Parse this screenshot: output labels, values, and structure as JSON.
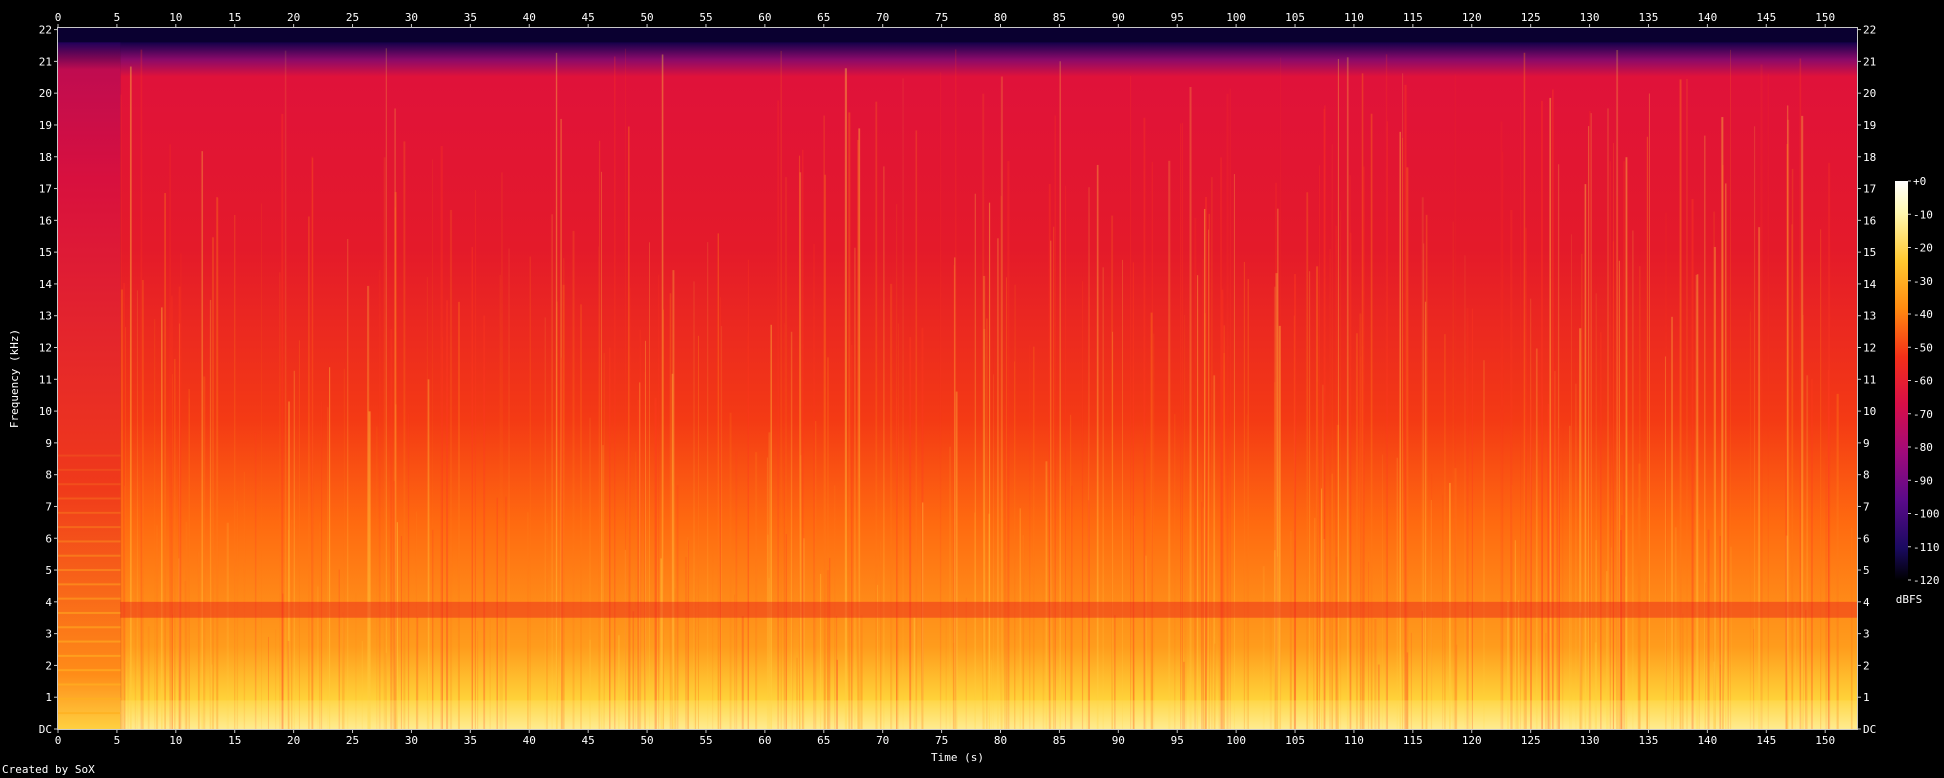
{
  "chart_data": {
    "type": "heatmap",
    "title": "",
    "xlabel": "Time (s)",
    "ylabel": "Frequency (kHz)",
    "x_range": [
      0,
      152.7
    ],
    "y_range": [
      0,
      22.05
    ],
    "x_ticks": [
      0,
      5,
      10,
      15,
      20,
      25,
      30,
      35,
      40,
      45,
      50,
      55,
      60,
      65,
      70,
      75,
      80,
      85,
      90,
      95,
      100,
      105,
      110,
      115,
      120,
      125,
      130,
      135,
      140,
      145,
      150
    ],
    "y_ticks": [
      "DC",
      "1",
      "2",
      "3",
      "4",
      "5",
      "6",
      "7",
      "8",
      "9",
      "10",
      "11",
      "12",
      "13",
      "14",
      "15",
      "16",
      "17",
      "18",
      "19",
      "20",
      "21",
      "22"
    ],
    "colorbar": {
      "label": "dBFS",
      "ticks": [
        "+0",
        "-10",
        "-20",
        "-30",
        "-40",
        "-50",
        "-60",
        "-70",
        "-80",
        "-90",
        "-100",
        "-110",
        "-120"
      ],
      "range": [
        -120,
        0
      ]
    },
    "features": {
      "intro_end_s": 5.3,
      "spectrum_cutoff_khz": 21.6,
      "dark_band_khz": [
        3.5,
        4.0
      ]
    }
  },
  "footer": {
    "credit": "Created by SoX"
  },
  "colors": {
    "background": "#000000",
    "axis": "#c8c8c8"
  }
}
